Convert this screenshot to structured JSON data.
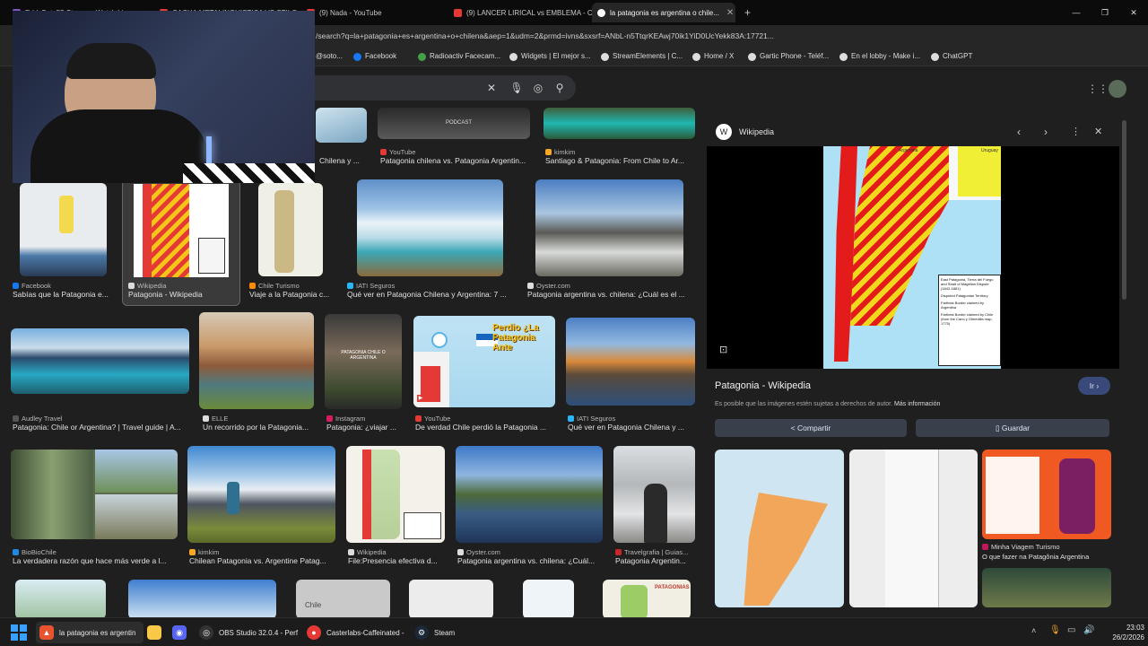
{
  "tabs": [
    {
      "label": "EddySoto55 Stream - Watch Live on..."
    },
    {
      "label": "CACHA METALINGUISTICA VS STILO..."
    },
    {
      "label": "(9) Nada - YouTube"
    },
    {
      "label": "(9) LANCER LIRICAL vs EMBLEMA - C..."
    },
    {
      "label": "la patagonia es argentina o chile...",
      "close": "✕"
    }
  ],
  "new_tab": "+",
  "window_controls": {
    "minimize": "—",
    "maximize": "❐",
    "close": "✕"
  },
  "address": {
    "url": "/search?q=la+patagonia+es+argentina+o+chilena&aep=1&udm=2&prmd=ivns&sxsrf=ANbL-n5TtqrKEAwj70ik1YiD0UcYekk83A:17721..."
  },
  "bookmarks": [
    {
      "label": "@soto...",
      "color": "#888888"
    },
    {
      "label": "Facebook",
      "color": "#1877f2"
    },
    {
      "label": "Radioactiv Facecam...",
      "color": "#43a047"
    },
    {
      "label": "Widgets | El mejor s...",
      "color": "#dddddd"
    },
    {
      "label": "StreamElements | C...",
      "color": "#dddddd"
    },
    {
      "label": "Home / X",
      "color": "#dddddd"
    },
    {
      "label": "Gartic Phone - Teléf...",
      "color": "#dddddd"
    },
    {
      "label": "En el lobby - Make i...",
      "color": "#dddddd"
    },
    {
      "label": "ChatGPT",
      "color": "#dddddd"
    }
  ],
  "search": {
    "clear": "✕"
  },
  "results": [
    {
      "source": "YouTube",
      "caption": "Patagonia chilena vs. Patagonia Argentin...",
      "src_color": "#e53935"
    },
    {
      "source": "kimkim",
      "caption": "Santiago & Patagonia: From Chile to Ar...",
      "src_color": "#f9a825"
    },
    {
      "source": "",
      "caption": "Chilena y ...",
      "src_color": "#555555"
    },
    {
      "source": "Facebook",
      "caption": "Sabías que la Patagonia e...",
      "src_color": "#1877f2"
    },
    {
      "source": "Wikipedia",
      "caption": "Patagonia - Wikipedia",
      "src_color": "#dddddd"
    },
    {
      "source": "Chile Turismo",
      "caption": "Viaje a la Patagonia c...",
      "src_color": "#fb8c00"
    },
    {
      "source": "IATI Seguros",
      "caption": "Qué ver en Patagonia Chilena y Argentina: 7 ...",
      "src_color": "#29b6f6"
    },
    {
      "source": "Oyster.com",
      "caption": "Patagonia argentina vs. chilena: ¿Cuál es el ...",
      "src_color": "#dddddd"
    },
    {
      "source": "Audley Travel",
      "caption": "Patagonia: Chile or Argentina? | Travel guide | A...",
      "src_color": "#555555"
    },
    {
      "source": "ELLE",
      "caption": "Un recorrido por la Patagonia...",
      "src_color": "#dddddd"
    },
    {
      "source": "Instagram",
      "caption": "Patagonia: ¿viajar ...",
      "src_color": "#d81b60"
    },
    {
      "source": "YouTube",
      "caption": "De verdad Chile perdió la Patagonia ...",
      "src_color": "#e53935"
    },
    {
      "source": "IATI Seguros",
      "caption": "Qué ver en Patagonia Chilena y ...",
      "src_color": "#29b6f6"
    },
    {
      "source": "BioBioChile",
      "caption": "La verdadera razón que hace más verde a l...",
      "src_color": "#1e88e5"
    },
    {
      "source": "kimkim",
      "caption": "Chilean Patagonia vs. Argentine Patag...",
      "src_color": "#f9a825"
    },
    {
      "source": "Wikipedia",
      "caption": "File:Presencia efectiva d...",
      "src_color": "#dddddd"
    },
    {
      "source": "Oyster.com",
      "caption": "Patagonia argentina vs. chilena: ¿Cuál...",
      "src_color": "#dddddd"
    },
    {
      "source": "Travelgrafia | Guias...",
      "caption": "Patagonia Argentin...",
      "src_color": "#c62828"
    }
  ],
  "thumb_texts": {
    "podcast": "PODCAST",
    "patagonia_chile_argentina": "PATAGONIA CHILE O ARGENTINA",
    "perdio": "Perdio ¿La Patagonia Ante",
    "chile_map": "Chile",
    "patagones": "PATAGONIAS"
  },
  "panel": {
    "site": "Wikipedia",
    "title": "Patagonia - Wikipedia",
    "notice_prefix": "Es posible que las imágenes estén sujetas a derechos de autor.",
    "notice_link": "Más información",
    "visit_btn": "Ir",
    "share_btn": "Compartir",
    "save_btn": "Guardar",
    "related_source": "Minha Viagem Turismo",
    "related_caption": "O que fazer na Patagônia Argentina",
    "map_uruguay": "Uruguay",
    "map_argentina": "Argentina",
    "legend_title": "East Patagonia, Tierra del Fuego and Strait of Magellan Dispute (1842-1881)",
    "legend_items": [
      "Disputed Patagonian Territory",
      "Farthest Border claimed by Argentina",
      "Farthest Border claimed by Chile (from the Cano y Olmedilla map, 1775)"
    ]
  },
  "taskbar": {
    "apps": [
      {
        "label": "la patagonia es argentin",
        "color": "#e8542f"
      },
      {
        "label": "",
        "color": "#f9c846"
      },
      {
        "label": "",
        "color": "#5865f2"
      },
      {
        "label": "OBS Studio 32.0.4 - Perf",
        "color": "#333333"
      },
      {
        "label": "Casterlabs-Caffeinated -",
        "color": "#e53935"
      },
      {
        "label": "Steam",
        "color": "#1b2838"
      }
    ],
    "time": "23:03",
    "date": "26/2/2026"
  }
}
